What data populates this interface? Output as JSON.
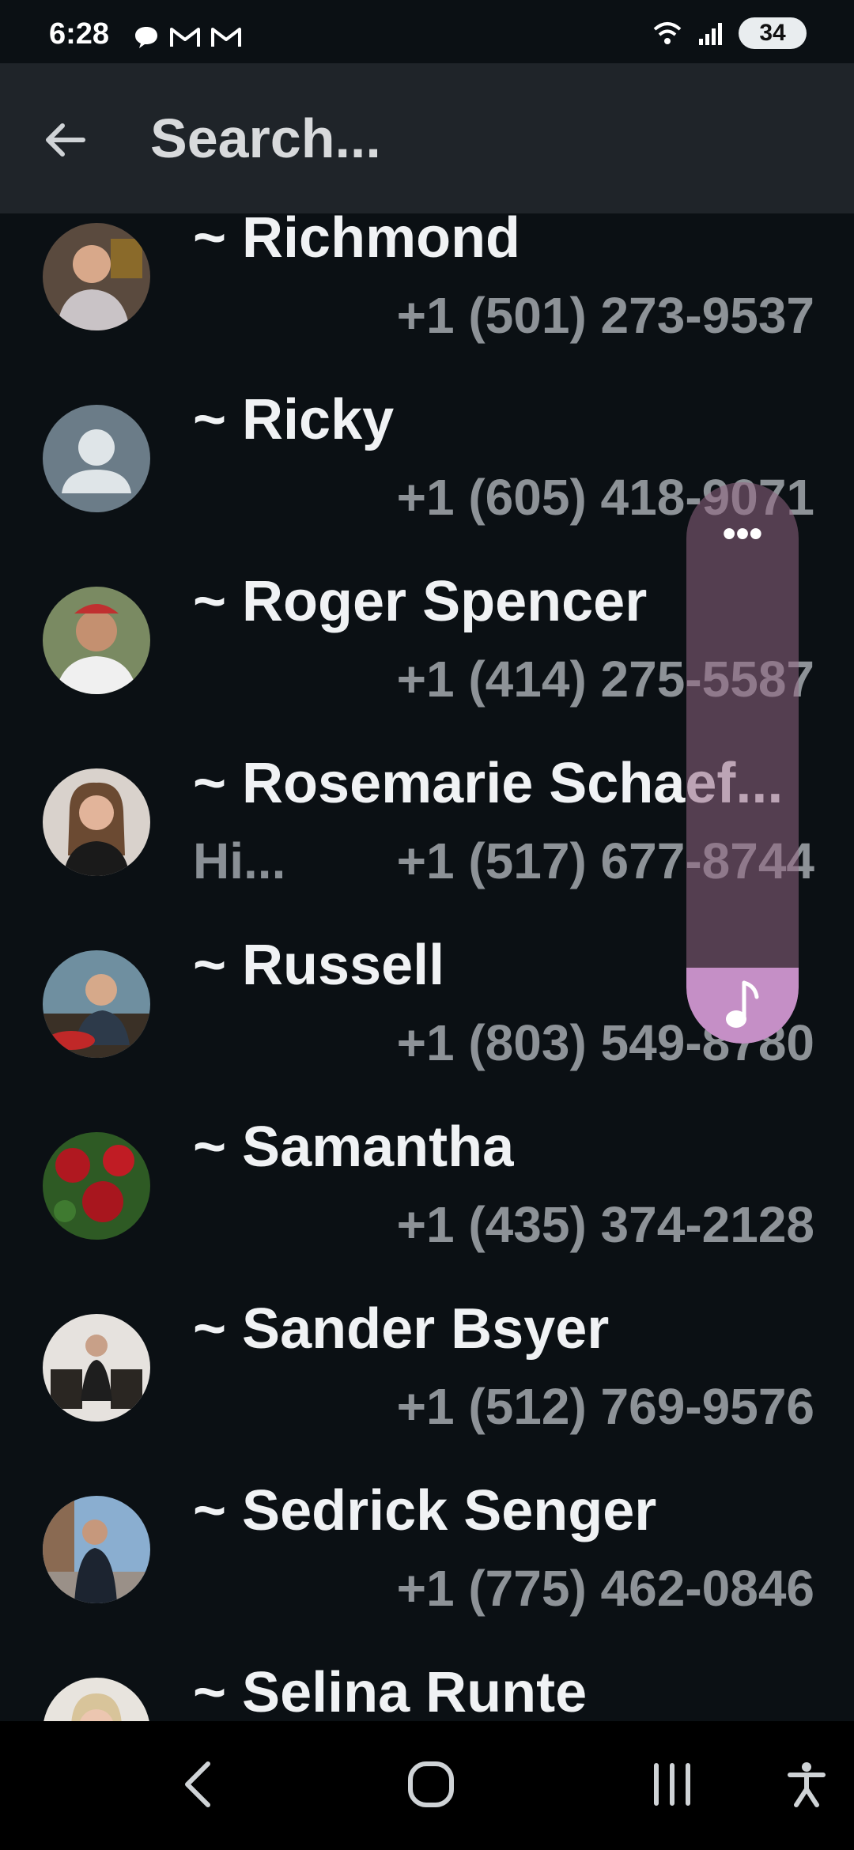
{
  "status_bar": {
    "time": "6:28",
    "battery": "34",
    "left_icons": [
      "chat-bubble-icon",
      "gmail-icon",
      "gmail-icon"
    ],
    "right_icons": [
      "wifi-icon",
      "signal-icon"
    ]
  },
  "top_bar": {
    "search_placeholder": "Search..."
  },
  "contacts": [
    {
      "name": "~ Richmond",
      "status": "",
      "phone": "+1 (501) 273-9537",
      "avatar": "photo"
    },
    {
      "name": "~ Ricky",
      "status": "",
      "phone": "+1 (605) 418-9071",
      "avatar": "default"
    },
    {
      "name": "~ Roger Spencer",
      "status": "",
      "phone": "+1 (414) 275-5587",
      "avatar": "photo"
    },
    {
      "name": "~ Rosemarie Schaef...",
      "status": "Hi...",
      "phone": "+1 (517) 677-8744",
      "avatar": "photo"
    },
    {
      "name": "~ Russell",
      "status": "",
      "phone": "+1 (803) 549-8780",
      "avatar": "photo"
    },
    {
      "name": "~ Samantha",
      "status": "",
      "phone": "+1 (435) 374-2128",
      "avatar": "roses"
    },
    {
      "name": "~ Sander Bsyer",
      "status": "",
      "phone": "+1 (512) 769-9576",
      "avatar": "photo"
    },
    {
      "name": "~ Sedrick Senger",
      "status": "",
      "phone": "+1 (775) 462-0846",
      "avatar": "photo"
    },
    {
      "name": "~ Selina Runte",
      "status": "",
      "phone": "",
      "avatar": "photo"
    }
  ],
  "side_panel": {
    "menu_icon": "more-dots-icon",
    "music_icon": "music-note-icon"
  },
  "nav_bar": {
    "icons": [
      "back-icon",
      "home-icon",
      "recents-icon",
      "accessibility-icon"
    ]
  }
}
